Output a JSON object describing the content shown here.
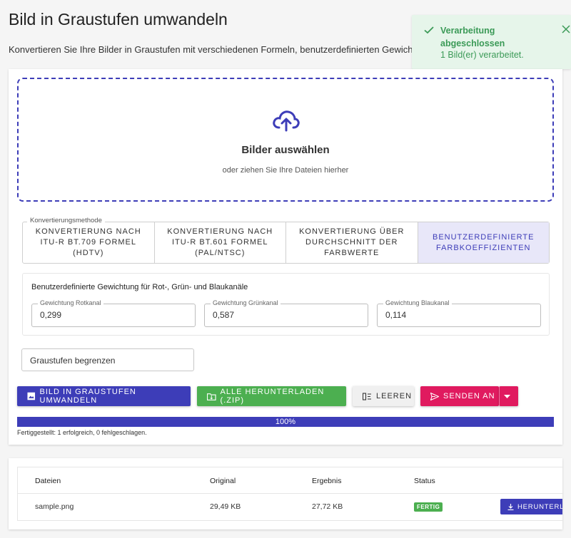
{
  "page": {
    "title": "Bild in Graustufen umwandeln",
    "description": "Konvertieren Sie Ihre Bilder in Graustufen mit verschiedenen Formeln, benutzerdefinierten Gewichtungen und Helligkeitsbegrenzung."
  },
  "toast": {
    "title": "Verarbeitung abgeschlossen",
    "message": "1 Bild(er) verarbeitet."
  },
  "dropzone": {
    "title": "Bilder auswählen",
    "subtitle": "oder ziehen Sie Ihre Dateien hierher"
  },
  "methods": {
    "legend": "Konvertierungsmethode",
    "items": [
      {
        "label": "Konvertierung nach ITU-R BT.709 Formel (HDTV)",
        "active": false
      },
      {
        "label": "Konvertierung nach ITU-R BT.601 Formel (PAL/NTSC)",
        "active": false
      },
      {
        "label": "Konvertierung über Durchschnitt der Farbwerte",
        "active": false
      },
      {
        "label": "Benutzerdefinierte Farbkoeffizienten",
        "active": true
      }
    ]
  },
  "weights": {
    "title": "Benutzerdefinierte Gewichtung für Rot-, Grün- und Blaukanäle",
    "red": {
      "label": "Gewichtung Rotkanal",
      "value": "0,299"
    },
    "green": {
      "label": "Gewichtung Grünkanal",
      "value": "0,587"
    },
    "blue": {
      "label": "Gewichtung Blaukanal",
      "value": "0,114"
    }
  },
  "limit": {
    "label": "Graustufen begrenzen"
  },
  "actions": {
    "convert": "Bild in Graustufen umwandeln",
    "download_zip": "Alle herunterladen (.zip)",
    "clear": "Leeren",
    "send": "Senden an"
  },
  "progress": {
    "value": 100,
    "label": "100%",
    "status": "Fertiggestellt: 1 erfolgreich, 0 fehlgeschlagen."
  },
  "table": {
    "headers": [
      "Dateien",
      "Original",
      "Ergebnis",
      "Status"
    ],
    "rows": [
      {
        "file": "sample.png",
        "original": "29,49 KB",
        "result": "27,72 KB",
        "status": "FERTIG",
        "action": "HERUNTERLADEN"
      }
    ]
  },
  "colors": {
    "primary": "#3d3db8",
    "success": "#4caf50",
    "accent": "#e01a5f",
    "toast_bg": "#e6f5ea"
  }
}
